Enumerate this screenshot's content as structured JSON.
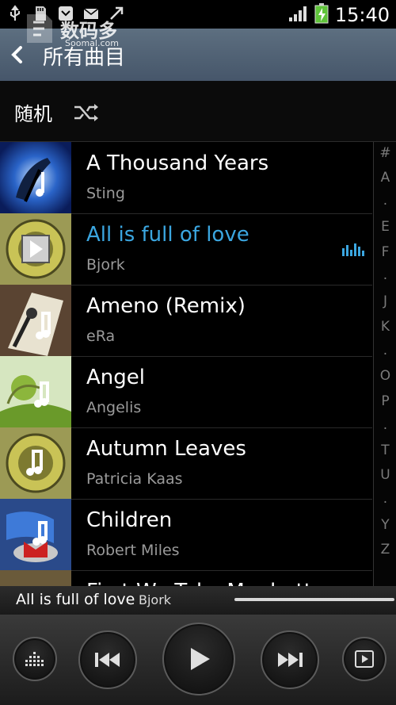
{
  "status_bar": {
    "time": "15:40"
  },
  "watermark": {
    "cn": "数码多",
    "en": "Soomal.com"
  },
  "header": {
    "title": "所有曲目"
  },
  "shuffle": {
    "label": "随机"
  },
  "songs": [
    {
      "title": "A Thousand Years",
      "artist": "Sting"
    },
    {
      "title": "All is full of love",
      "artist": "Bjork",
      "playing": true
    },
    {
      "title": "Ameno (Remix)",
      "artist": "eRa"
    },
    {
      "title": "Angel",
      "artist": "Angelis"
    },
    {
      "title": "Autumn Leaves",
      "artist": "Patricia Kaas"
    },
    {
      "title": "Children",
      "artist": "Robert Miles"
    },
    {
      "title": "First We Take Manhattan",
      "artist": ""
    }
  ],
  "index": [
    "#",
    "A",
    ".",
    "E",
    "F",
    ".",
    "J",
    "K",
    ".",
    "O",
    "P",
    ".",
    "T",
    "U",
    ".",
    "Y",
    "Z"
  ],
  "now_playing": {
    "title": "All is full of love",
    "artist": "Bjork"
  },
  "controls": {
    "icons": [
      "equalizer-icon",
      "previous-icon",
      "play-icon",
      "next-icon",
      "playlist-icon"
    ]
  },
  "colors": {
    "accent": "#3ba6e0",
    "title_bar": "#52647a"
  }
}
